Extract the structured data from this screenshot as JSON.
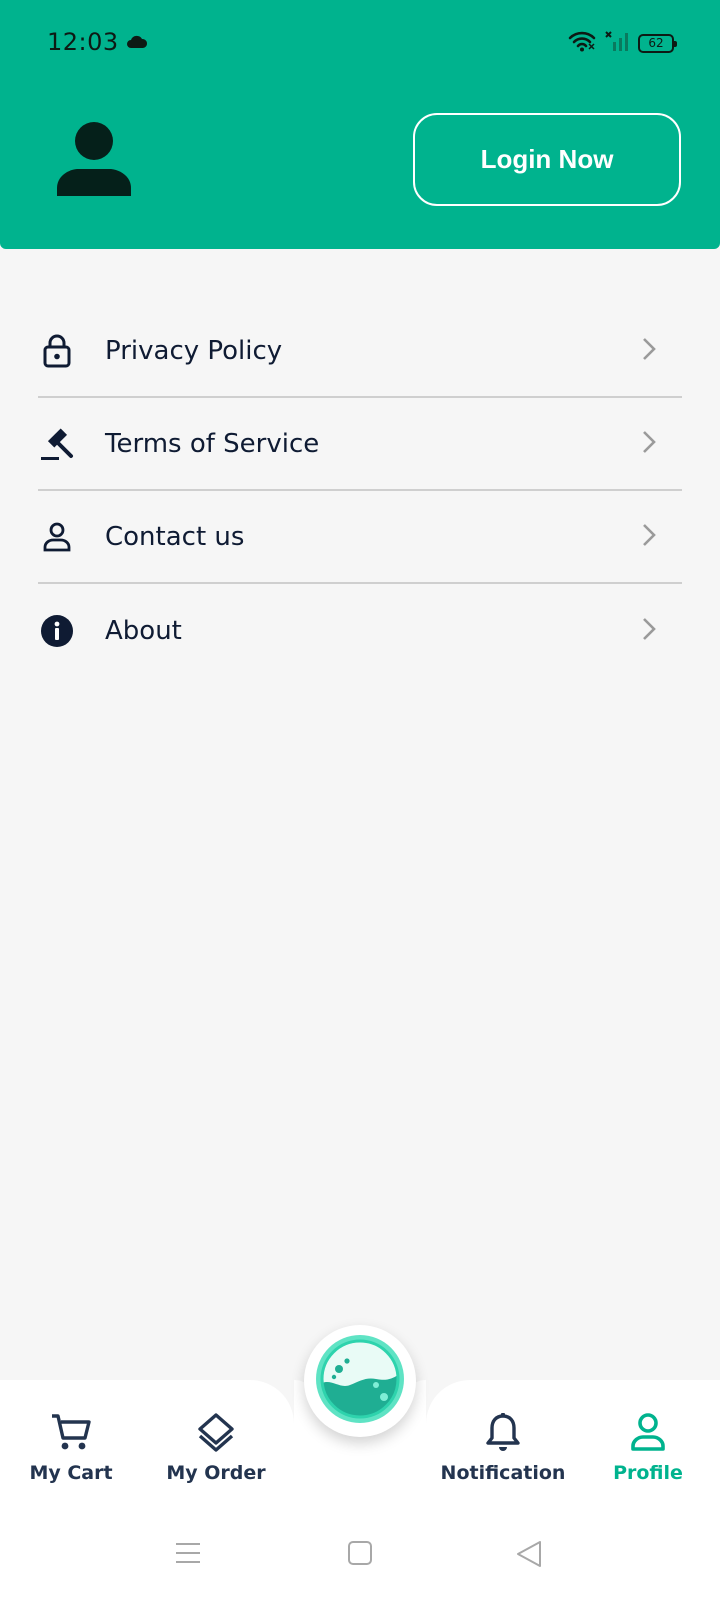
{
  "status_bar": {
    "time": "12:03",
    "battery": "62"
  },
  "header": {
    "login_label": "Login Now",
    "accent_color": "#00b38e"
  },
  "menu": {
    "items": [
      {
        "label": "Privacy Policy",
        "icon": "lock-icon"
      },
      {
        "label": "Terms of Service",
        "icon": "gavel-icon"
      },
      {
        "label": "Contact us",
        "icon": "person-outline-icon"
      },
      {
        "label": "About",
        "icon": "info-icon"
      }
    ]
  },
  "bottom_nav": {
    "items": [
      {
        "label": "My Cart",
        "icon": "cart-icon"
      },
      {
        "label": "My Order",
        "icon": "layers-icon"
      },
      {
        "label": "Notification",
        "icon": "bell-icon"
      },
      {
        "label": "Profile",
        "icon": "person-icon",
        "active": true
      }
    ],
    "center_button_icon": "washing-machine-icon"
  },
  "system_nav": [
    "menu-icon",
    "home-icon",
    "back-icon"
  ]
}
